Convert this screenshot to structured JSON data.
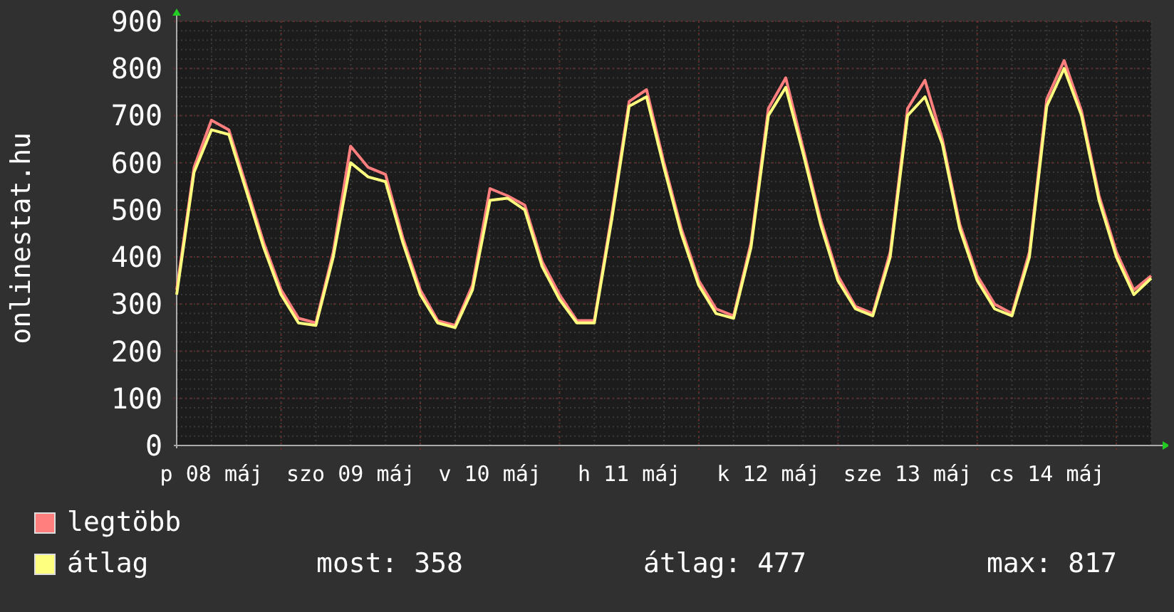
{
  "y_axis_label": "onlinestat.hu",
  "chart": {
    "chart_data": {
      "type": "line",
      "categories": [
        null,
        null,
        "p 08 máj",
        null,
        null,
        null,
        null,
        null,
        null,
        null,
        "szo 09 máj",
        null,
        null,
        null,
        null,
        null,
        null,
        null,
        "v 10 máj",
        null,
        null,
        null,
        null,
        null,
        null,
        null,
        "h 11 máj",
        null,
        null,
        null,
        null,
        null,
        null,
        null,
        "k 12 máj",
        null,
        null,
        null,
        null,
        null,
        null,
        null,
        "sze 13 máj",
        null,
        null,
        null,
        null,
        null,
        null,
        null,
        "cs 14 máj",
        null,
        null,
        null,
        null,
        null,
        null
      ],
      "ylim": [
        0,
        900
      ],
      "grid": true,
      "yticks": [
        0,
        100,
        200,
        300,
        400,
        500,
        600,
        700,
        800,
        900
      ],
      "series": [
        {
          "name": "legtöbb",
          "color": "#ff7f7f",
          "values": [
            330,
            590,
            690,
            670,
            550,
            430,
            330,
            270,
            260,
            410,
            635,
            590,
            575,
            440,
            330,
            265,
            255,
            340,
            545,
            530,
            510,
            390,
            320,
            265,
            265,
            490,
            730,
            755,
            600,
            460,
            350,
            290,
            275,
            430,
            715,
            780,
            630,
            480,
            360,
            295,
            280,
            410,
            715,
            775,
            650,
            470,
            360,
            300,
            280,
            410,
            735,
            817,
            710,
            530,
            410,
            330,
            360
          ]
        },
        {
          "name": "átlag",
          "color": "#ffff7f",
          "values": [
            320,
            580,
            670,
            660,
            540,
            420,
            320,
            260,
            255,
            400,
            600,
            570,
            560,
            430,
            320,
            260,
            250,
            330,
            520,
            525,
            500,
            380,
            310,
            260,
            260,
            480,
            720,
            740,
            590,
            450,
            340,
            280,
            270,
            420,
            700,
            760,
            620,
            470,
            350,
            290,
            275,
            400,
            700,
            740,
            640,
            460,
            350,
            290,
            275,
            400,
            720,
            800,
            700,
            520,
            400,
            320,
            355
          ]
        }
      ]
    }
  },
  "stats": [
    "most: 358",
    "átlag: 477",
    "max: 817"
  ]
}
